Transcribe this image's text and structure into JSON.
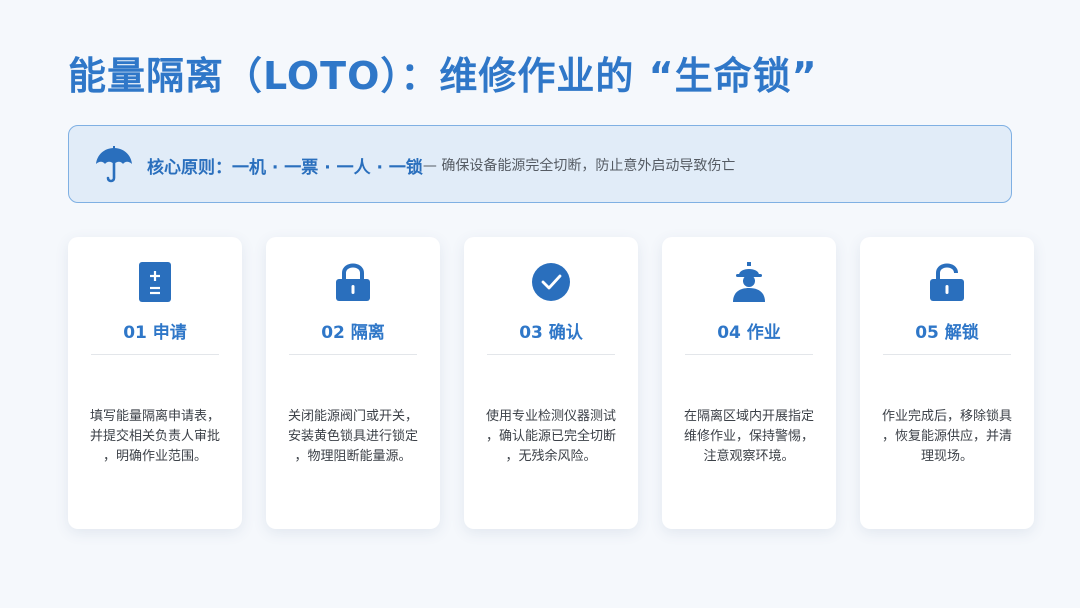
{
  "title": "能量隔离（LOTO）：维修作业的 “生命锁”",
  "principle": {
    "icon": "umbrella-icon",
    "label": "核心原则：一机 · 一票 · 一人 · 一锁",
    "note": "— 确保设备能源完全切断，防止意外启动导致伤亡"
  },
  "colors": {
    "accent": "#2f77c8",
    "icon": "#2a6fbd",
    "box_bg": "#e1ecf8",
    "box_border": "#7fb0e3"
  },
  "steps": [
    {
      "title": "01 申请",
      "icon": "form-icon",
      "desc": [
        "填写能量隔离申请表，",
        "并提交相关负责人审批",
        "，明确作业范围。"
      ]
    },
    {
      "title": "02 隔离",
      "icon": "lock-icon",
      "desc": [
        "关闭能源阀门或开关，",
        "安装黄色锁具进行锁定",
        "，物理阻断能量源。"
      ]
    },
    {
      "title": "03 确认",
      "icon": "check-circle-icon",
      "desc": [
        "使用专业检测仪器测试",
        "，确认能源已完全切断",
        "，无残余风险。"
      ]
    },
    {
      "title": "04 作业",
      "icon": "worker-icon",
      "desc": [
        "在隔离区域内开展指定",
        "维修作业，保持警惕，",
        "注意观察环境。"
      ]
    },
    {
      "title": "05 解锁",
      "icon": "unlock-icon",
      "desc": [
        "作业完成后，移除锁具",
        "，恢复能源供应，并清",
        "理现场。"
      ]
    }
  ]
}
